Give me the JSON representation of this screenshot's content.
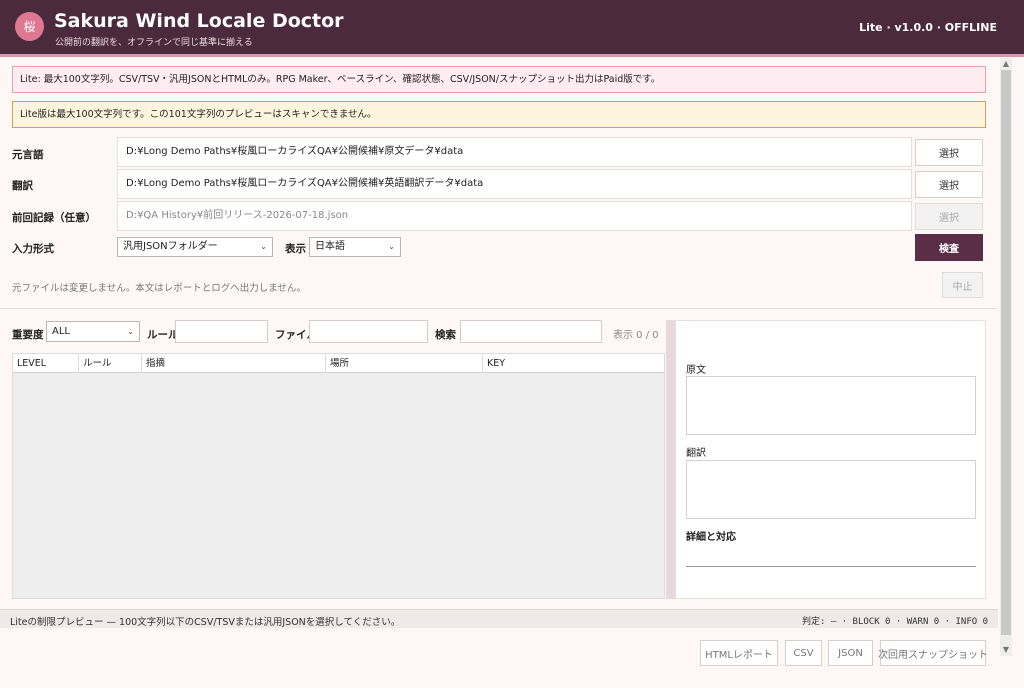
{
  "header": {
    "logo_char": "桜",
    "title": "Sakura Wind Locale Doctor",
    "subtitle": "公開前の翻訳を、オフラインで同じ基準に揃える",
    "version": "Lite · v1.0.0 · OFFLINE"
  },
  "notices": {
    "lite": "Lite: 最大100文字列。CSV/TSV・汎用JSONとHTMLのみ。RPG Maker、ベースライン、確認状態、CSV/JSON/スナップショット出力はPaid版です。",
    "warning": "Lite版は最大100文字列です。この101文字列のプレビューはスキャンできません。"
  },
  "form": {
    "source_label": "元言語",
    "source_path": "D:¥Long Demo Paths¥桜風ローカライズQA¥公開候補¥原文データ¥data",
    "translation_label": "翻訳",
    "translation_path": "D:¥Long Demo Paths¥桜風ローカライズQA¥公開候補¥英語翻訳データ¥data",
    "history_label": "前回記録（任意）",
    "history_path": "D:¥QA History¥前回リリース-2026-07-18.json",
    "select_label": "選択",
    "input_format_label": "入力形式",
    "input_format_value": "汎用JSONフォルダー",
    "display_label": "表示",
    "display_value": "日本語",
    "scan_label": "検査",
    "stop_label": "中止",
    "hint": "元ファイルは変更しません。本文はレポートとログへ出力しません。"
  },
  "filters": {
    "severity_label": "重要度",
    "severity_value": "ALL",
    "rule_label": "ルール",
    "file_label": "ファイル",
    "search_label": "検索",
    "count": "表示 0 / 0"
  },
  "table": {
    "columns": [
      "LEVEL",
      "ルール",
      "指摘",
      "場所",
      "KEY"
    ]
  },
  "detail": {
    "source_label": "原文",
    "translation_label": "翻訳",
    "detail_label": "詳細と対応"
  },
  "status": {
    "left": "Liteの制限プレビュー — 100文字列以下のCSV/TSVまたは汎用JSONを選択してください。",
    "right": "判定: — · BLOCK 0 · WARN 0 · INFO 0"
  },
  "bottom_buttons": {
    "html": "HTMLレポート",
    "csv": "CSV",
    "json": "JSON",
    "snapshot": "次回用スナップショット"
  }
}
